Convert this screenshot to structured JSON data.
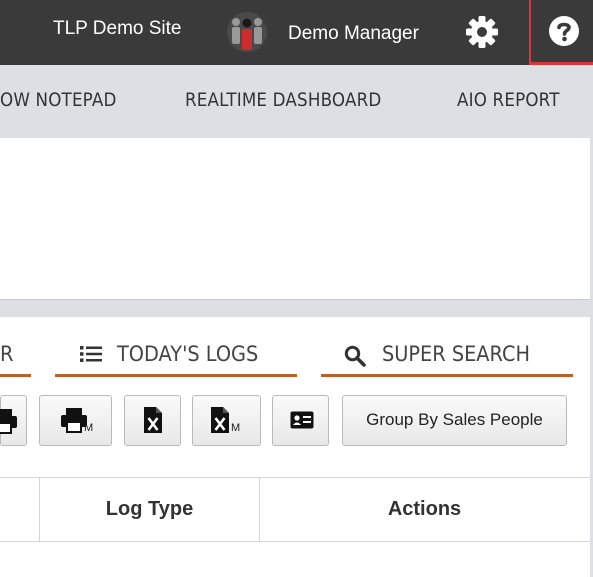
{
  "header": {
    "site_name": "TLP Demo Site",
    "user_name": "Demo Manager",
    "avatar_icon": "users-avatar-icon",
    "settings_icon": "gear-icon",
    "help_icon": "question-circle-icon",
    "help_highlight_color": "#d9363e"
  },
  "nav": {
    "items": [
      {
        "label": "OW NOTEPAD"
      },
      {
        "label": "REALTIME DASHBOARD"
      },
      {
        "label": "AIO REPORT"
      }
    ]
  },
  "tabs": [
    {
      "label": "R"
    },
    {
      "label": "TODAY'S LOGS",
      "icon": "list-icon"
    },
    {
      "label": "SUPER SEARCH",
      "icon": "search-icon"
    }
  ],
  "tab_accent_color": "#b8612a",
  "toolbar": {
    "buttons": [
      {
        "icon": "print-icon",
        "sub": ""
      },
      {
        "icon": "print-icon",
        "sub": "M"
      },
      {
        "icon": "excel-icon",
        "sub": ""
      },
      {
        "icon": "excel-icon",
        "sub": "M"
      },
      {
        "icon": "contact-card-icon",
        "sub": ""
      }
    ],
    "group_label": "Group By Sales People"
  },
  "table": {
    "headers": [
      "Log Type",
      "Actions"
    ]
  }
}
